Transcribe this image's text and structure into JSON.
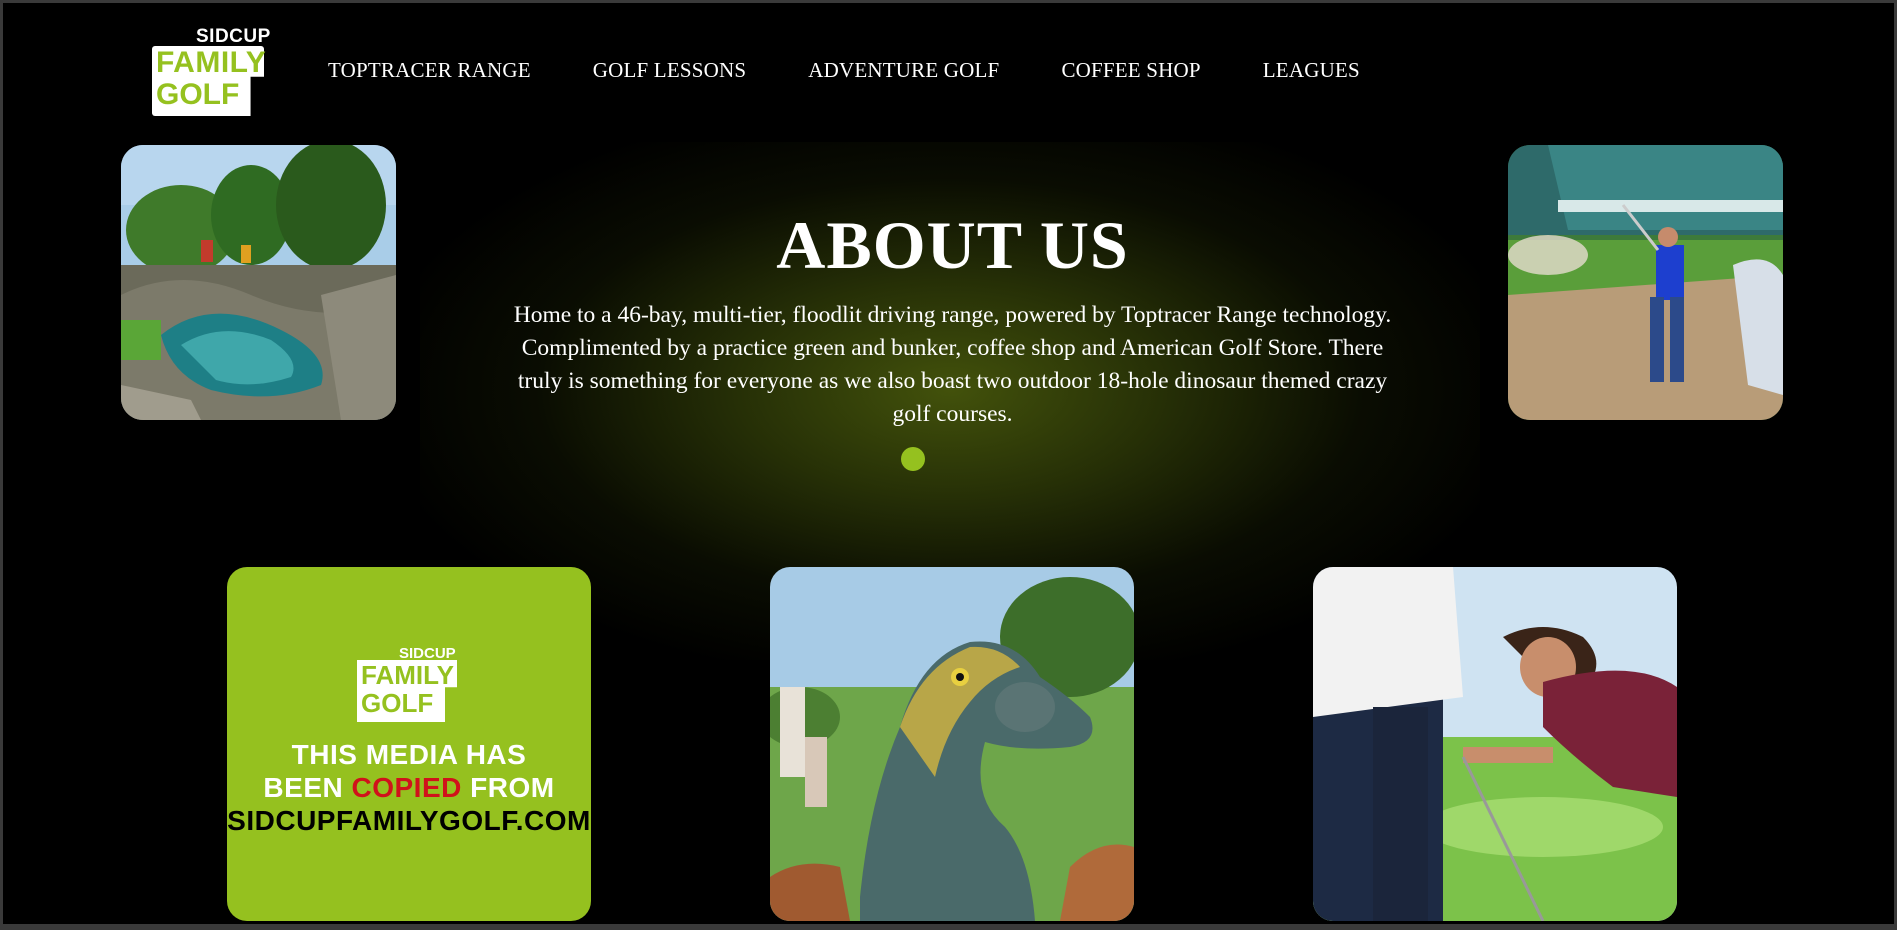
{
  "logo": {
    "line1": "SIDCUP",
    "line2": "FAMILY",
    "line3": "GOLF"
  },
  "nav": {
    "items": [
      "TOPTRACER RANGE",
      "GOLF LESSONS",
      "ADVENTURE GOLF",
      "COFFEE SHOP",
      "LEAGUES"
    ]
  },
  "about": {
    "title": "ABOUT US",
    "text": "Home to a 46-bay, multi-tier, floodlit driving range, powered by Toptracer Range technology. Complimented by a practice green and bunker, coffee shop and American Golf Store. There truly is something for everyone as we also boast two outdoor 18-hole dinosaur themed crazy golf courses."
  },
  "watermark": {
    "line1": "THIS MEDIA HAS",
    "line2_prefix": "BEEN ",
    "line2_highlight": "COPIED",
    "line2_suffix": " FROM",
    "line3": "SIDCUPFAMILYGOLF.COM"
  },
  "colors": {
    "accent": "#95c11f",
    "background": "#000000",
    "highlight": "#d0121b"
  }
}
